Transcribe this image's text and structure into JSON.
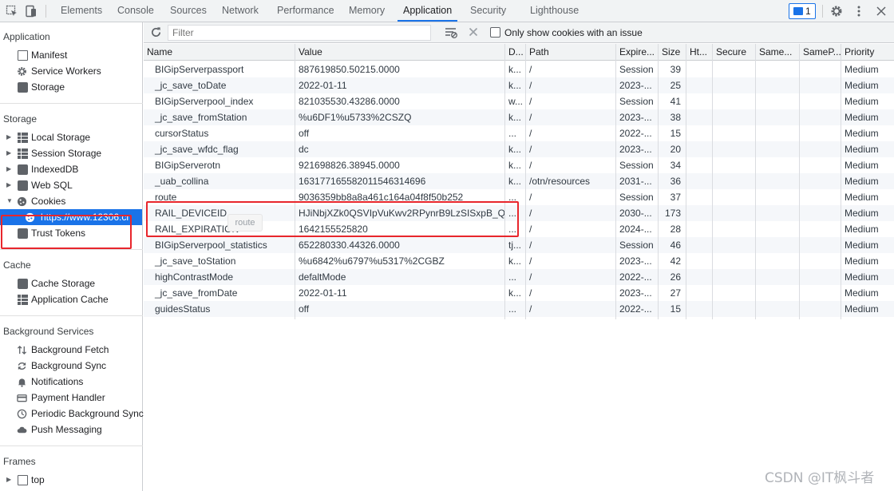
{
  "topbar": {
    "tabs": [
      {
        "label": "Elements",
        "active": false
      },
      {
        "label": "Console",
        "active": false
      },
      {
        "label": "Sources",
        "active": false
      },
      {
        "label": "Network",
        "active": false
      },
      {
        "label": "Performance",
        "active": false
      },
      {
        "label": "Memory",
        "active": false
      },
      {
        "label": "Application",
        "active": true
      },
      {
        "label": "Security",
        "active": false
      },
      {
        "label": "Lighthouse",
        "active": false
      }
    ],
    "issues_count": "1",
    "icons": [
      "inspect-element-icon",
      "device-toolbar-icon",
      "settings-gear-icon",
      "more-options-icon"
    ]
  },
  "sidebar": {
    "application": {
      "title": "Application",
      "items": [
        {
          "label": "Manifest",
          "icon": "document-icon"
        },
        {
          "label": "Service Workers",
          "icon": "gear-icon"
        },
        {
          "label": "Storage",
          "icon": "database-icon"
        }
      ]
    },
    "storage": {
      "title": "Storage",
      "items": [
        {
          "label": "Local Storage",
          "icon": "grid-icon",
          "expandable": true
        },
        {
          "label": "Session Storage",
          "icon": "grid-icon",
          "expandable": true
        },
        {
          "label": "IndexedDB",
          "icon": "database-icon",
          "expandable": true
        },
        {
          "label": "Web SQL",
          "icon": "database-icon",
          "expandable": true
        },
        {
          "label": "Cookies",
          "icon": "cookie-icon",
          "expandable": true,
          "expanded": true
        },
        {
          "label": "https://www.12306.cn",
          "icon": "cookie-icon",
          "selected": true
        },
        {
          "label": "Trust Tokens",
          "icon": "database-icon"
        }
      ]
    },
    "cache": {
      "title": "Cache",
      "items": [
        {
          "label": "Cache Storage",
          "icon": "database-icon"
        },
        {
          "label": "Application Cache",
          "icon": "grid-icon"
        }
      ]
    },
    "background_services": {
      "title": "Background Services",
      "items": [
        {
          "label": "Background Fetch",
          "icon": "fetch-arrows-icon"
        },
        {
          "label": "Background Sync",
          "icon": "sync-icon"
        },
        {
          "label": "Notifications",
          "icon": "bell-icon"
        },
        {
          "label": "Payment Handler",
          "icon": "card-icon"
        },
        {
          "label": "Periodic Background Sync",
          "icon": "clock-icon"
        },
        {
          "label": "Push Messaging",
          "icon": "cloud-icon"
        }
      ]
    },
    "frames": {
      "title": "Frames",
      "items": [
        {
          "label": "top",
          "icon": "frame-icon",
          "expandable": true
        }
      ]
    }
  },
  "toolbar": {
    "filter_placeholder": "Filter",
    "only_issues_label": "Only show cookies with an issue",
    "only_issues_checked": false
  },
  "table": {
    "columns": [
      "Name",
      "Value",
      "D...",
      "Path",
      "Expire...",
      "Size",
      "Ht...",
      "Secure",
      "Same...",
      "SameP...",
      "Priority"
    ],
    "rows": [
      [
        "BIGipServerpassport",
        "887619850.50215.0000",
        "k...",
        "/",
        "Session",
        "39",
        "",
        "",
        "",
        "",
        "Medium"
      ],
      [
        "_jc_save_toDate",
        "2022-01-11",
        "k...",
        "/",
        "2023-...",
        "25",
        "",
        "",
        "",
        "",
        "Medium"
      ],
      [
        "BIGipServerpool_index",
        "821035530.43286.0000",
        "w...",
        "/",
        "Session",
        "41",
        "",
        "",
        "",
        "",
        "Medium"
      ],
      [
        "_jc_save_fromStation",
        "%u6DF1%u5733%2CSZQ",
        "k...",
        "/",
        "2023-...",
        "38",
        "",
        "",
        "",
        "",
        "Medium"
      ],
      [
        "cursorStatus",
        "off",
        "...",
        "/",
        "2022-...",
        "15",
        "",
        "",
        "",
        "",
        "Medium"
      ],
      [
        "_jc_save_wfdc_flag",
        "dc",
        "k...",
        "/",
        "2023-...",
        "20",
        "",
        "",
        "",
        "",
        "Medium"
      ],
      [
        "BIGipServerotn",
        "921698826.38945.0000",
        "k...",
        "/",
        "Session",
        "34",
        "",
        "",
        "",
        "",
        "Medium"
      ],
      [
        "_uab_collina",
        "163177165582011546314696",
        "k...",
        "/otn/resources",
        "2031-...",
        "36",
        "",
        "",
        "",
        "",
        "Medium"
      ],
      [
        "route",
        "9036359bb8a8a461c164a04f8f50b252",
        "...",
        "/",
        "Session",
        "37",
        "",
        "",
        "",
        "",
        "Medium"
      ],
      [
        "RAIL_DEVICEID",
        "HJiNbjXZk0QSVIpVuKwv2RPynrB9LzSISxpB_Q...",
        "...",
        "/",
        "2030-...",
        "173",
        "",
        "",
        "",
        "",
        "Medium"
      ],
      [
        "RAIL_EXPIRATION",
        "1642155525820",
        "...",
        "/",
        "2024-...",
        "28",
        "",
        "",
        "",
        "",
        "Medium"
      ],
      [
        "BIGipServerpool_statistics",
        "652280330.44326.0000",
        "tj...",
        "/",
        "Session",
        "46",
        "",
        "",
        "",
        "",
        "Medium"
      ],
      [
        "_jc_save_toStation",
        "%u6842%u6797%u5317%2CGBZ",
        "k...",
        "/",
        "2023-...",
        "42",
        "",
        "",
        "",
        "",
        "Medium"
      ],
      [
        "highContrastMode",
        "defaltMode",
        "...",
        "/",
        "2022-...",
        "26",
        "",
        "",
        "",
        "",
        "Medium"
      ],
      [
        "_jc_save_fromDate",
        "2022-01-11",
        "k...",
        "/",
        "2023-...",
        "27",
        "",
        "",
        "",
        "",
        "Medium"
      ],
      [
        "guidesStatus",
        "off",
        "...",
        "/",
        "2022-...",
        "15",
        "",
        "",
        "",
        "",
        "Medium"
      ]
    ]
  },
  "tooltip_text": "route",
  "annotation_color": "#e8262c",
  "accent_color": "#1a73e8",
  "watermark": "CSDN @IT枫斗者"
}
